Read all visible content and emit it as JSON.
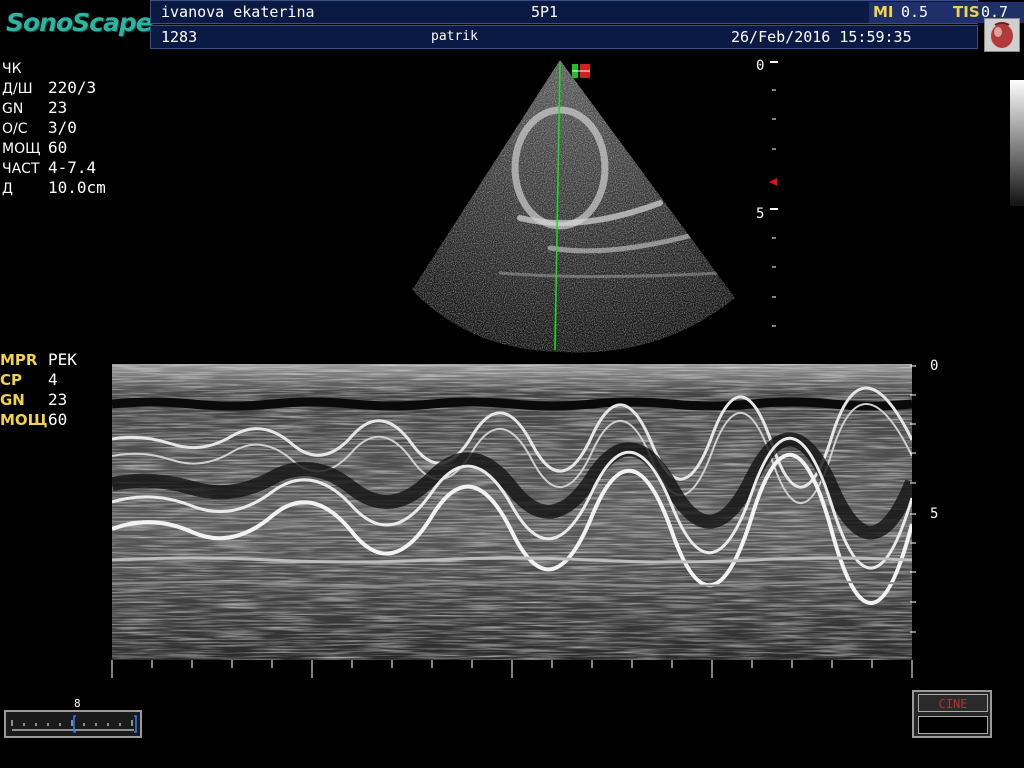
{
  "header": {
    "logo": "SonoScape",
    "patient_name": "ivanova ekaterina",
    "probe": "5P1",
    "mi_label": "MI",
    "mi_value": "0.5",
    "tis_label": "TIS",
    "tis_value": "0.7",
    "patient_id": "1283",
    "exam_label": "patrik",
    "datetime": "26/Feb/2016 15:59:35"
  },
  "bmode_params": [
    {
      "label": "ЧК",
      "value": ""
    },
    {
      "label": "Д/Ш",
      "value": "220/3"
    },
    {
      "label": "GN",
      "value": "23"
    },
    {
      "label": "О/С",
      "value": "3/0"
    },
    {
      "label": "МОЩ",
      "value": "60"
    },
    {
      "label": "ЧАСТ",
      "value": "4-7.4"
    },
    {
      "label": "Д",
      "value": "10.0cm"
    }
  ],
  "mmode_params": [
    {
      "label": "MPR",
      "value": "РЕК"
    },
    {
      "label": "CP",
      "value": "4"
    },
    {
      "label": "GN",
      "value": "23"
    },
    {
      "label": "МОЩ",
      "value": "60"
    }
  ],
  "bmode_scale": {
    "top": "0",
    "mid": "5"
  },
  "mmode_scale": {
    "top": "0",
    "mid": "5"
  },
  "tgc": {
    "value": "8"
  },
  "cine": {
    "label": "CINE"
  },
  "colors": {
    "accent": "#2fb3a0",
    "header_bg": "#0b1a45",
    "label_yellow": "#f2d24a",
    "scan_line": "#18e018",
    "cine_red": "#c52a2a"
  }
}
